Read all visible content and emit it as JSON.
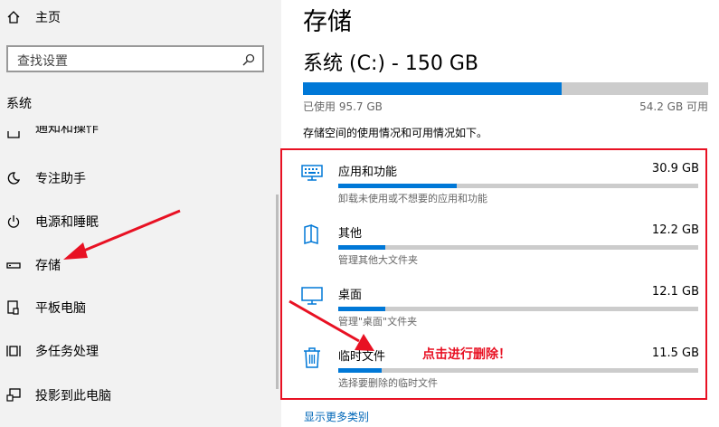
{
  "sidebar": {
    "home_label": "主页",
    "search_placeholder": "查找设置",
    "section_label": "系统",
    "items": [
      {
        "label": "通知和操作",
        "icon": "notification-icon"
      },
      {
        "label": "专注助手",
        "icon": "moon-icon"
      },
      {
        "label": "电源和睡眠",
        "icon": "power-icon"
      },
      {
        "label": "存储",
        "icon": "storage-icon"
      },
      {
        "label": "平板电脑",
        "icon": "tablet-icon"
      },
      {
        "label": "多任务处理",
        "icon": "multitask-icon"
      },
      {
        "label": "投影到此电脑",
        "icon": "project-icon"
      }
    ]
  },
  "main": {
    "title": "存储",
    "drive_label": "系统 (C:) - 150 GB",
    "used_fraction": 0.638,
    "used_label": "已使用 95.7 GB",
    "available_label": "54.2 GB 可用",
    "description": "存储空间的使用情况和可用情况如下。",
    "categories": [
      {
        "name": "应用和功能",
        "size": "30.9 GB",
        "subtitle": "卸载未使用或不想要的应用和功能",
        "fraction": 0.33,
        "icon": "apps-icon"
      },
      {
        "name": "其他",
        "size": "12.2 GB",
        "subtitle": "管理其他大文件夹",
        "fraction": 0.13,
        "icon": "other-icon"
      },
      {
        "name": "桌面",
        "size": "12.1 GB",
        "subtitle": "管理\"桌面\"文件夹",
        "fraction": 0.13,
        "icon": "desktop-icon"
      },
      {
        "name": "临时文件",
        "size": "11.5 GB",
        "subtitle": "选择要删除的临时文件",
        "fraction": 0.12,
        "icon": "trash-icon"
      }
    ],
    "show_more": "显示更多类别"
  },
  "annotation": {
    "text": "点击进行删除！",
    "color": "#e81123"
  },
  "colors": {
    "accent": "#0078d7",
    "highlight": "#e81123"
  }
}
